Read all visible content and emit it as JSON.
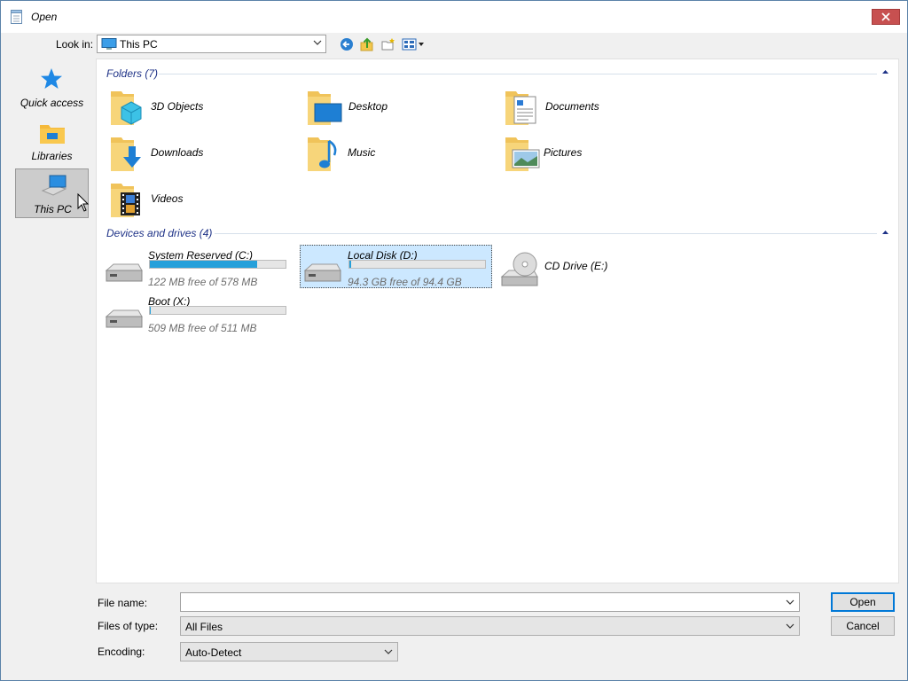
{
  "window": {
    "title": "Open",
    "close_label": "✕"
  },
  "lookin": {
    "label": "Look in:",
    "value": "This PC"
  },
  "toolbar": {
    "back_icon": "back-arrow-icon",
    "up_icon": "up-folder-icon",
    "new_folder_icon": "new-folder-icon",
    "view_icon": "view-menu-icon"
  },
  "places": [
    {
      "label": "Quick access",
      "icon": "star-icon"
    },
    {
      "label": "Libraries",
      "icon": "libraries-icon"
    },
    {
      "label": "This PC",
      "icon": "computer-icon"
    }
  ],
  "folders": {
    "header": "Folders (7)",
    "items": [
      {
        "label": "3D Objects"
      },
      {
        "label": "Desktop"
      },
      {
        "label": "Documents"
      },
      {
        "label": "Downloads"
      },
      {
        "label": "Music"
      },
      {
        "label": "Pictures"
      },
      {
        "label": "Videos"
      }
    ]
  },
  "drives": {
    "header": "Devices and drives (4)",
    "items": [
      {
        "label": "System Reserved (C:)",
        "free": "122 MB free of 578 MB",
        "used_fraction": 0.79
      },
      {
        "label": "Local Disk (D:)",
        "free": "94.3 GB free of 94.4 GB",
        "used_fraction": 0.01
      },
      {
        "label": "CD Drive (E:)"
      },
      {
        "label": "Boot (X:)",
        "free": "509 MB free of 511 MB",
        "used_fraction": 0.004
      }
    ]
  },
  "form": {
    "file_name_label": "File name:",
    "file_name_value": "",
    "files_of_type_label": "Files of type:",
    "files_of_type_value": "All Files",
    "encoding_label": "Encoding:",
    "encoding_value": "Auto-Detect"
  },
  "buttons": {
    "open": "Open",
    "cancel": "Cancel"
  },
  "colors": {
    "accent": "#0078d7",
    "drive_bar": "#26a0da",
    "close": "#c75050",
    "group_header": "#1e3287"
  }
}
